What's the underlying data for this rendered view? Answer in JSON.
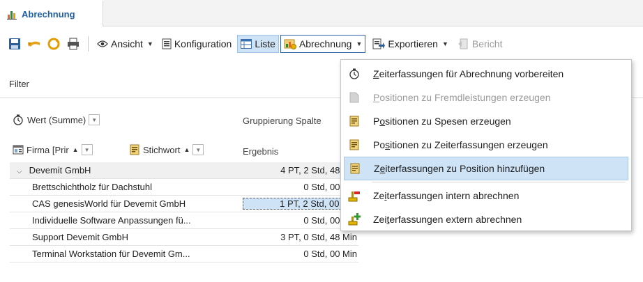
{
  "tab": {
    "title": "Abrechnung"
  },
  "toolbar": {
    "ansicht": "Ansicht",
    "konfiguration": "Konfiguration",
    "liste": "Liste",
    "abrechnung": "Abrechnung",
    "exportieren": "Exportieren",
    "bericht": "Bericht"
  },
  "filter_label": "Filter",
  "wert_chip": "Wert (Summe)",
  "gruppierung_label": "Gruppierung Spalte",
  "firma_chip": "Firma [Prir",
  "stichwort_chip": "Stichwort",
  "ergebnis_label": "Ergebnis",
  "tree": {
    "parent": {
      "label": "Devemit GmbH",
      "value": "4 PT, 2 Std, 48 Min"
    },
    "children": [
      {
        "label": "Brettschichtholz für Dachstuhl",
        "value": "0 Std, 00 Min"
      },
      {
        "label": "CAS genesisWorld für Devemit GmbH",
        "value": "1 PT, 2 Std, 00 Min"
      },
      {
        "label": "Individuelle Software Anpassungen fü...",
        "value": "0 Std, 00 Min"
      },
      {
        "label": "Support Devemit GmbH",
        "value": "3 PT, 0 Std, 48 Min"
      },
      {
        "label": "Terminal Workstation für Devemit Gm...",
        "value": "0 Std, 00 Min"
      }
    ]
  },
  "menu": {
    "items": [
      {
        "pre": "",
        "u": "Z",
        "post": "eiterfassungen für Abrechnung vorbereiten"
      },
      {
        "pre": "",
        "u": "P",
        "post": "ositionen zu Fremdleistungen erzeugen"
      },
      {
        "pre": "P",
        "u": "o",
        "post": "sitionen zu Spesen erzeugen"
      },
      {
        "pre": "Po",
        "u": "s",
        "post": "itionen zu Zeiterfassungen erzeugen"
      },
      {
        "pre": "Z",
        "u": "e",
        "post": "iterfassungen zu Position hinzufügen"
      },
      {
        "pre": "Ze",
        "u": "i",
        "post": "terfassungen intern abrechnen"
      },
      {
        "pre": "Zei",
        "u": "t",
        "post": "erfassungen extern abrechnen"
      }
    ]
  },
  "colors": {
    "accent": "#1f5fa8",
    "selection": "#cfe3f7",
    "disabled": "#9a9a9a"
  }
}
